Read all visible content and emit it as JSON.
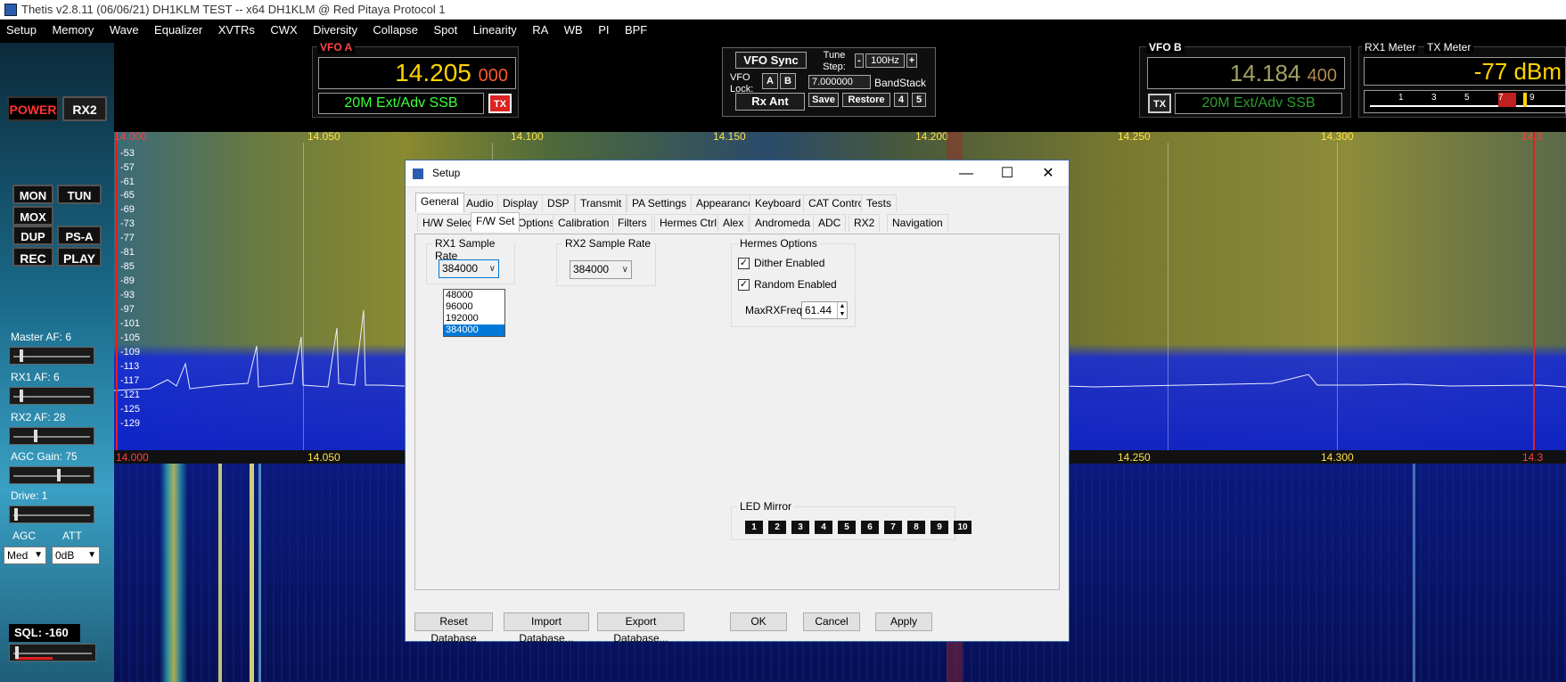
{
  "window": {
    "title": "Thetis v2.8.11 (06/06/21) DH1KLM TEST   --   x64 DH1KLM @ Red Pitaya Protocol 1"
  },
  "menu": [
    "Setup",
    "Memory",
    "Wave",
    "Equalizer",
    "XVTRs",
    "CWX",
    "Diversity",
    "Collapse",
    "Spot",
    "Linearity",
    "RA",
    "WB",
    "PI",
    "BPF"
  ],
  "left_panel": {
    "power": "POWER",
    "rx2": "RX2",
    "mon": "MON",
    "tun": "TUN",
    "mox": "MOX",
    "dup": "DUP",
    "psa": "PS-A",
    "rec": "REC",
    "play": "PLAY",
    "master_af": "Master AF:  6",
    "rx1_af": "RX1 AF:  6",
    "rx2_af": "RX2 AF:  28",
    "agc_gain": "AGC Gain:  75",
    "drive": "Drive:  1",
    "agc_label": "AGC",
    "att_label": "ATT",
    "agc_value": "Med",
    "att_value": "0dB",
    "sql": "SQL:  -160",
    "master_af_level": 0.08,
    "rx1_af_level": 0.08,
    "rx2_af_level": 0.28,
    "agc_gain_level": 0.6,
    "drive_level": 0.01
  },
  "vfo_a": {
    "title": "VFO A",
    "freq_main": "14.205",
    "freq_sub": "000",
    "mode": "20M Ext/Adv SSB",
    "tx": "TX"
  },
  "vfo_b": {
    "title": "VFO B",
    "freq_main": "14.184",
    "freq_sub": "400",
    "mode": "20M Ext/Adv SSB",
    "tx": "TX"
  },
  "vfo_sync": {
    "sync": "VFO Sync",
    "tune_step_label": "Tune Step:",
    "minus": "-",
    "tune_step_value": "100Hz",
    "plus": "+",
    "vfo_lock": "VFO Lock:",
    "a": "A",
    "b": "B",
    "bandstack_freq": "7.000000",
    "bandstack_label": "BandStack",
    "rx_ant": "Rx Ant",
    "save": "Save",
    "restore": "Restore",
    "four": "4",
    "five": "5"
  },
  "meter": {
    "rx1_tab": "RX1 Meter",
    "tx_tab": "TX Meter",
    "readout": "-77 dBm",
    "scale": [
      "1",
      "3",
      "5",
      "7",
      "9"
    ]
  },
  "spectrum": {
    "top_ticks": [
      "14.000",
      "14.050",
      "14.100",
      "14.150",
      "14.200",
      "14.250",
      "14.300",
      "14.3"
    ],
    "bottom_ticks": [
      "14.000",
      "14.050",
      "14.250",
      "14.300",
      "14.3"
    ],
    "db_labels": [
      "-53",
      "-57",
      "-61",
      "-65",
      "-69",
      "-73",
      "-77",
      "-81",
      "-85",
      "-89",
      "-93",
      "-97",
      "-101",
      "-105",
      "-109",
      "-113",
      "-117",
      "-121",
      "-125",
      "-129"
    ]
  },
  "setup": {
    "title": "Setup",
    "minimize": "—",
    "maximize": "☐",
    "close": "✕",
    "tabs_row1": [
      "General",
      "Audio",
      "Display",
      "DSP",
      "Transmit",
      "PA Settings",
      "Appearance",
      "Keyboard",
      "CAT Control",
      "Tests"
    ],
    "tabs_row2": [
      "H/W Select",
      "F/W Set",
      "Options",
      "Calibration",
      "Filters",
      "Hermes Ctrl",
      "Alex",
      "Andromeda",
      "ADC",
      "RX2",
      "Navigation"
    ],
    "rx1_group": "RX1 Sample Rate",
    "rx1_value": "384000",
    "rx1_options": [
      "48000",
      "96000",
      "192000",
      "384000"
    ],
    "rx2_group": "RX2 Sample Rate",
    "rx2_value": "384000",
    "hermes_group": "Hermes Options",
    "dither": "Dither Enabled",
    "random": "Random Enabled",
    "maxrx_label": "MaxRXFreq:",
    "maxrx_value": "61.44",
    "led_group": "LED Mirror",
    "leds": [
      "1",
      "2",
      "3",
      "4",
      "5",
      "6",
      "7",
      "8",
      "9",
      "10"
    ],
    "buttons": {
      "reset": "Reset Database",
      "import": "Import Database...",
      "export": "Export Database...",
      "ok": "OK",
      "cancel": "Cancel",
      "apply": "Apply"
    }
  }
}
